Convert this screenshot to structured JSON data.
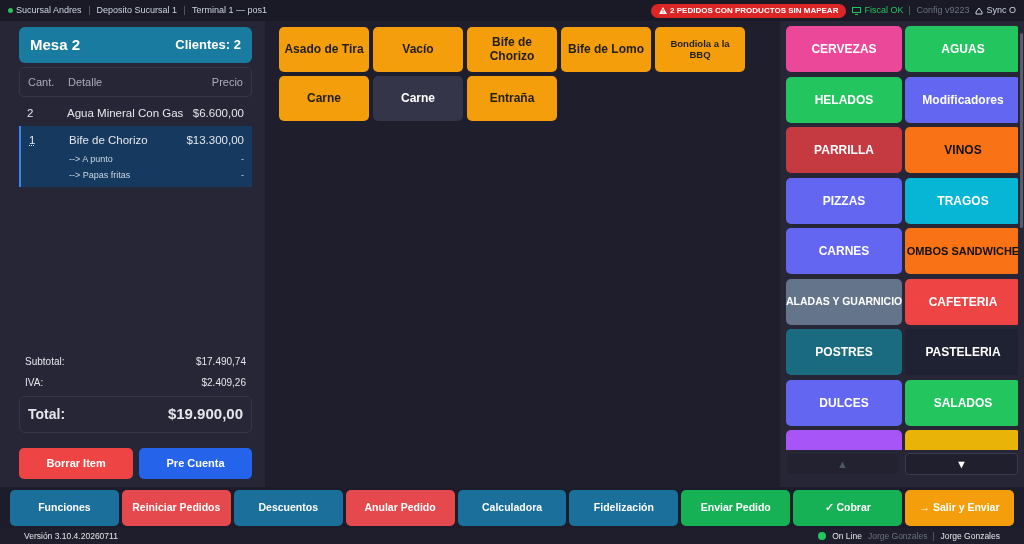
{
  "top_bar": {
    "online": true,
    "items": [
      "Sucursal Andres",
      "Deposito Sucursal 1",
      "Terminal 1 — pos1"
    ],
    "alert": "2 PEDIDOS CON PRODUCTOS SIN MAPEAR",
    "fiscal": "Fiscal OK",
    "config": "Config v9223",
    "sync": "Sync O"
  },
  "order": {
    "title": "Mesa 2",
    "clients": "Clientes: 2",
    "columns": [
      "Cant.",
      "Detalle",
      "Precio"
    ],
    "rows": [
      {
        "qty": "2",
        "detail": "Agua Mineral Con Gas",
        "price": "$6.600,00",
        "selected": false,
        "children": []
      },
      {
        "qty": "1",
        "detail": "Bife de Chorizo",
        "price": "$13.300,00",
        "selected": true,
        "children": [
          {
            "detail": "--> A punto",
            "price": "-"
          },
          {
            "detail": "--> Papas fritas",
            "price": "-"
          }
        ]
      }
    ],
    "subtotal_label": "Subtotal:",
    "subtotal": "$17.490,74",
    "iva_label": "IVA:",
    "iva": "$2.409,26",
    "total_label": "Total:",
    "total": "$19.900,00",
    "buttons": [
      {
        "label": "Borrar Item",
        "color": "#ef4444"
      },
      {
        "label": "Pre Cuenta",
        "color": "#2563eb"
      }
    ]
  },
  "products": [
    {
      "label": "Asado de Tira",
      "selected": false,
      "kind": "normal"
    },
    {
      "label": "Vacío",
      "selected": false,
      "kind": "normal"
    },
    {
      "label": "Bife de Chorizo",
      "selected": false,
      "kind": "normal"
    },
    {
      "label": "Bife de Lomo",
      "selected": false,
      "kind": "normal"
    },
    {
      "label": "Bondiola a la BBQ",
      "selected": false,
      "kind": "small"
    },
    {
      "label": "Carne",
      "selected": false,
      "kind": "normal"
    },
    {
      "label": "Carne",
      "selected": true,
      "kind": "normal"
    },
    {
      "label": "Entraña",
      "selected": false,
      "kind": "normal"
    }
  ],
  "categories": [
    {
      "label": "CERVEZAS",
      "color": "#ec4899"
    },
    {
      "label": "AGUAS",
      "color": "#22c55e"
    },
    {
      "label": "HELADOS",
      "color": "#22c55e"
    },
    {
      "label": "Modificadores",
      "color": "#6366f1"
    },
    {
      "label": "PARRILLA",
      "color": "#c53a40"
    },
    {
      "label": "VINOS",
      "color": "#f97316"
    },
    {
      "label": "PIZZAS",
      "color": "#6366f1"
    },
    {
      "label": "TRAGOS",
      "color": "#06b6d4"
    },
    {
      "label": "CARNES",
      "color": "#6366f1"
    },
    {
      "label": "OMBOS SANDWICHE",
      "color": "#f97316"
    },
    {
      "label": "ALADAS Y GUARNICIO",
      "color": "#64748b"
    },
    {
      "label": "CAFETERIA",
      "color": "#ef4444"
    },
    {
      "label": "POSTRES",
      "color": "#1a6b80"
    },
    {
      "label": "PASTELERIA",
      "color": "#1e2233"
    },
    {
      "label": "DULCES",
      "color": "#6366f1"
    },
    {
      "label": "SALADOS",
      "color": "#22c55e"
    },
    {
      "color": "#a855f7"
    },
    {
      "color": "#eab308"
    }
  ],
  "category_nav": [
    {
      "label": "▲",
      "disabled": true
    },
    {
      "label": "▼",
      "disabled": false
    }
  ],
  "actions": [
    {
      "label": "Funciones",
      "color": "#1a6f9b"
    },
    {
      "label": "Reiniciar Pedidos",
      "color": "#e5484d"
    },
    {
      "label": "Descuentos",
      "color": "#1a6f9b"
    },
    {
      "label": "Anular Pedido",
      "color": "#e5484d"
    },
    {
      "label": "Calculadora",
      "color": "#1a6f9b"
    },
    {
      "label": "Fidelización",
      "color": "#1a6f9b"
    },
    {
      "label": "Enviar Pedido",
      "color": "#16b055"
    },
    {
      "label": "✓ Cobrar",
      "color": "#16b055"
    },
    {
      "label": "→ Salir y Enviar",
      "color": "#f59e0b"
    }
  ],
  "status_bar": {
    "version": "Versión 3.10.4.20260711",
    "online": true,
    "online_label": "On Line",
    "user_faded": "Jorge Gonzales",
    "user": "Jorge Gonzales"
  }
}
